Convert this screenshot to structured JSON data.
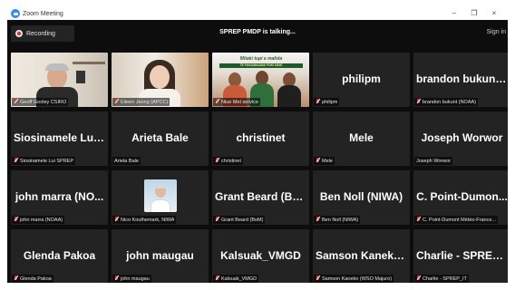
{
  "window": {
    "title": "Zoom Meeting",
    "controls": [
      "–",
      "❐",
      "×"
    ]
  },
  "topbar": {
    "recording_label": "Recording",
    "talking": "SPREP PMDP is talking...",
    "signin": "Sign in"
  },
  "tiles": [
    {
      "big": "",
      "name": "Geoff Gooley CSIRO",
      "kind": "video-office"
    },
    {
      "big": "",
      "name": "Eileen Jeong (APCC)",
      "kind": "video-home"
    },
    {
      "big": "",
      "name": "Niue Met service",
      "kind": "video-group",
      "banner": "Mitaki tupi e mafola",
      "banner_sub": "TE FAKAMAAMA FOKI NIUE"
    },
    {
      "big": "philipm",
      "name": "philipm"
    },
    {
      "big": "brandon bukunt...",
      "name": "brandon bukunt (NOAA)"
    },
    {
      "big": "Siosinamele Lui_...",
      "name": "Siosinamele Lui SPREP"
    },
    {
      "big": "Arieta Bale",
      "name": "Arieta Bale",
      "nomic": true
    },
    {
      "big": "christinet",
      "name": "christinet"
    },
    {
      "big": "Mele",
      "name": "Mele"
    },
    {
      "big": "Joseph Worwor",
      "name": "Joseph Worwor",
      "nomic": true
    },
    {
      "big": "john marra (NO...",
      "name": "john marra (NOAA)"
    },
    {
      "big": "",
      "name": "Nico Kouthemark, NIWA",
      "kind": "photo"
    },
    {
      "big": "Grant Beard (Bo...",
      "name": "Grant Beard (BoM)"
    },
    {
      "big": "Ben Noll (NIWA)",
      "name": "Ben Noll (NIWA)"
    },
    {
      "big": "C. Point-Dumon...",
      "name": "C. Point-Dumont Météo-France..."
    },
    {
      "big": "Glenda Pakoa",
      "name": "Glenda Pakoa"
    },
    {
      "big": "john maugau",
      "name": "john maugau"
    },
    {
      "big": "Kalsuak_VMGD",
      "name": "Kalsuak_VMGD"
    },
    {
      "big": "Samson Kaneko...",
      "name": "Samson Kaneko (WSO Majuro)"
    },
    {
      "big": "Charlie - SPREP_IT",
      "name": "Charlie - SPREP_IT"
    }
  ],
  "colors": {
    "tile_bg": "#232323",
    "mic_muted": "#e53935",
    "window_bg": "#0d0d0d",
    "zoom_blue": "#2D8CFF"
  },
  "icons": {
    "recording": "record-icon",
    "mic": "mic-muted-icon",
    "app": "zoom-logo-icon"
  }
}
